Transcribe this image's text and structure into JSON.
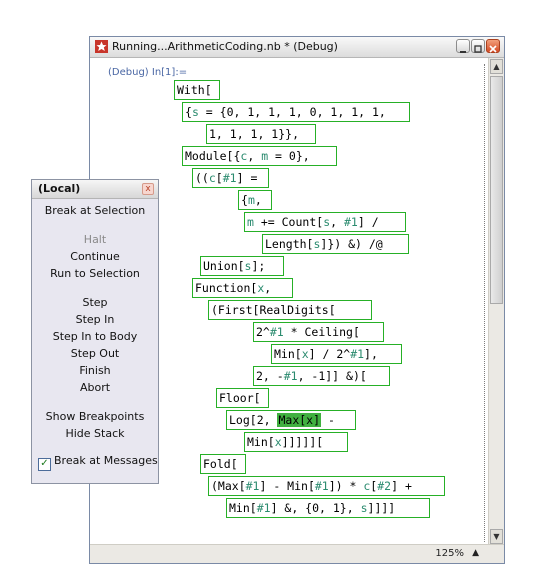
{
  "window": {
    "title": "Running...ArithmeticCoding.nb * (Debug)",
    "input_label": "(Debug) In[1]:=",
    "zoom": "125%",
    "zoom_arrow": "▲",
    "scroll_up": "▲",
    "scroll_down": "▼"
  },
  "debugger": {
    "title": "(Local)",
    "close": "x",
    "items": {
      "break_at_selection": "Break at Selection",
      "halt": "Halt",
      "continue": "Continue",
      "run_to_selection": "Run to Selection",
      "step": "Step",
      "step_in": "Step In",
      "step_in_to_body": "Step In to Body",
      "step_out": "Step Out",
      "finish": "Finish",
      "abort": "Abort",
      "show_breakpoints": "Show Breakpoints",
      "hide_stack": "Hide Stack"
    },
    "break_at_messages": {
      "label": "Break at Messages",
      "checked": true,
      "mark": "✓"
    }
  },
  "code": {
    "l1": "With[",
    "l2a": "{",
    "l2b": "s",
    "l2c": " = {0, 1, 1, 1, 0, 1, 1, 1,",
    "l3": "1, 1, 1, 1}},",
    "l4a": "Module[{",
    "l4b": "c",
    "l4c": ", ",
    "l4d": "m",
    "l4e": " = 0},",
    "l5a": "((",
    "l5b": "c",
    "l5c": "[",
    "l5d": "#1",
    "l5e": "] =",
    "l6a": "{",
    "l6b": "m",
    "l6c": ",",
    "l7a": "m",
    "l7b": " += Count[",
    "l7c": "s",
    "l7d": ", ",
    "l7e": "#1",
    "l7f": "] /",
    "l8a": "Length[",
    "l8b": "s",
    "l8c": "]}) &) /@",
    "l9a": "Union[",
    "l9b": "s",
    "l9c": "];",
    "l10a": "Function[",
    "l10b": "x",
    "l10c": ",",
    "l11": "(First[RealDigits[",
    "l12a": "2^",
    "l12b": "#1",
    "l12c": " * Ceiling[",
    "l13a": "Min[",
    "l13b": "x",
    "l13c": "] / 2^",
    "l13d": "#1",
    "l13e": "],",
    "l14a": "2, -",
    "l14b": "#1",
    "l14c": ", -1]] &)[",
    "l15": "Floor[",
    "l16a": "Log[2, ",
    "l16b": "Max[",
    "l16c": "x",
    "l16d": "]",
    "l16e": " -",
    "l17a": "Min[",
    "l17b": "x",
    "l17c": "]]]]][",
    "l18": "Fold[",
    "l19a": "(Max[",
    "l19b": "#1",
    "l19c": "] - Min[",
    "l19d": "#1",
    "l19e": "]) * ",
    "l19f": "c",
    "l19g": "[",
    "l19h": "#2",
    "l19i": "] +",
    "l20a": "Min[",
    "l20b": "#1",
    "l20c": "] &, {0, 1}, ",
    "l20d": "s",
    "l20e": "]]]]"
  }
}
